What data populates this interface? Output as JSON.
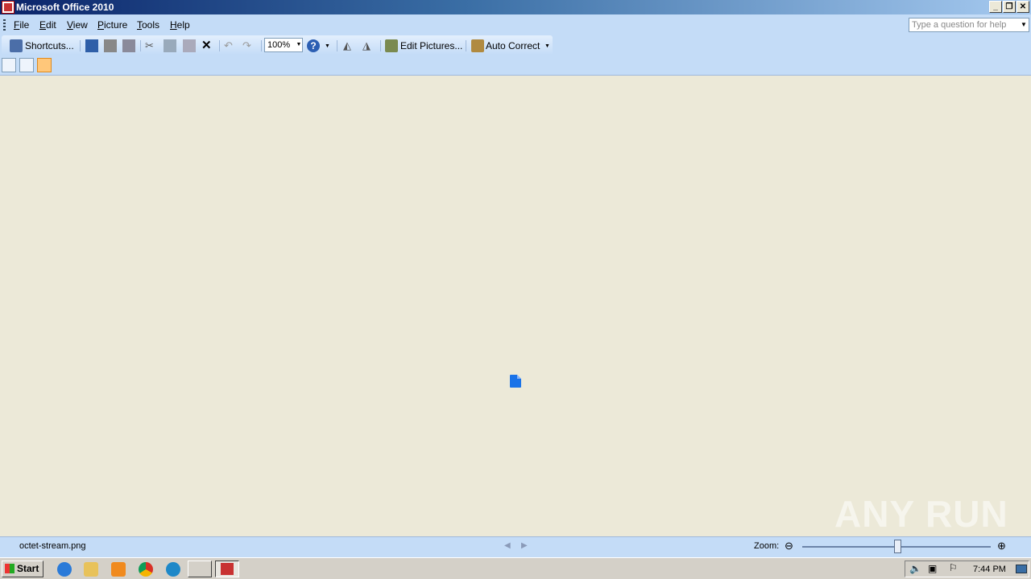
{
  "window": {
    "title": "Microsoft Office 2010"
  },
  "menu": {
    "items": [
      {
        "label": "File",
        "key": "F",
        "rest": "ile"
      },
      {
        "label": "Edit",
        "key": "E",
        "rest": "dit"
      },
      {
        "label": "View",
        "key": "V",
        "rest": "iew"
      },
      {
        "label": "Picture",
        "key": "P",
        "rest": "icture"
      },
      {
        "label": "Tools",
        "key": "T",
        "rest": "ools"
      },
      {
        "label": "Help",
        "key": "H",
        "rest": "elp"
      }
    ],
    "help_placeholder": "Type a question for help"
  },
  "toolbar": {
    "shortcuts_label": "Shortcuts...",
    "zoom_value": "100%",
    "edit_pictures_label": "Edit Pictures...",
    "auto_correct_label": "Auto Correct"
  },
  "statusbar": {
    "filename": "octet-stream.png",
    "zoom_label": "Zoom:"
  },
  "watermark": "ANY RUN",
  "taskbar": {
    "start_label": "Start",
    "clock": "7:44 PM"
  },
  "colors": {
    "menubar": "#c4dcf7",
    "canvas": "#ece9d8",
    "file_icon": "#1a73e8"
  }
}
